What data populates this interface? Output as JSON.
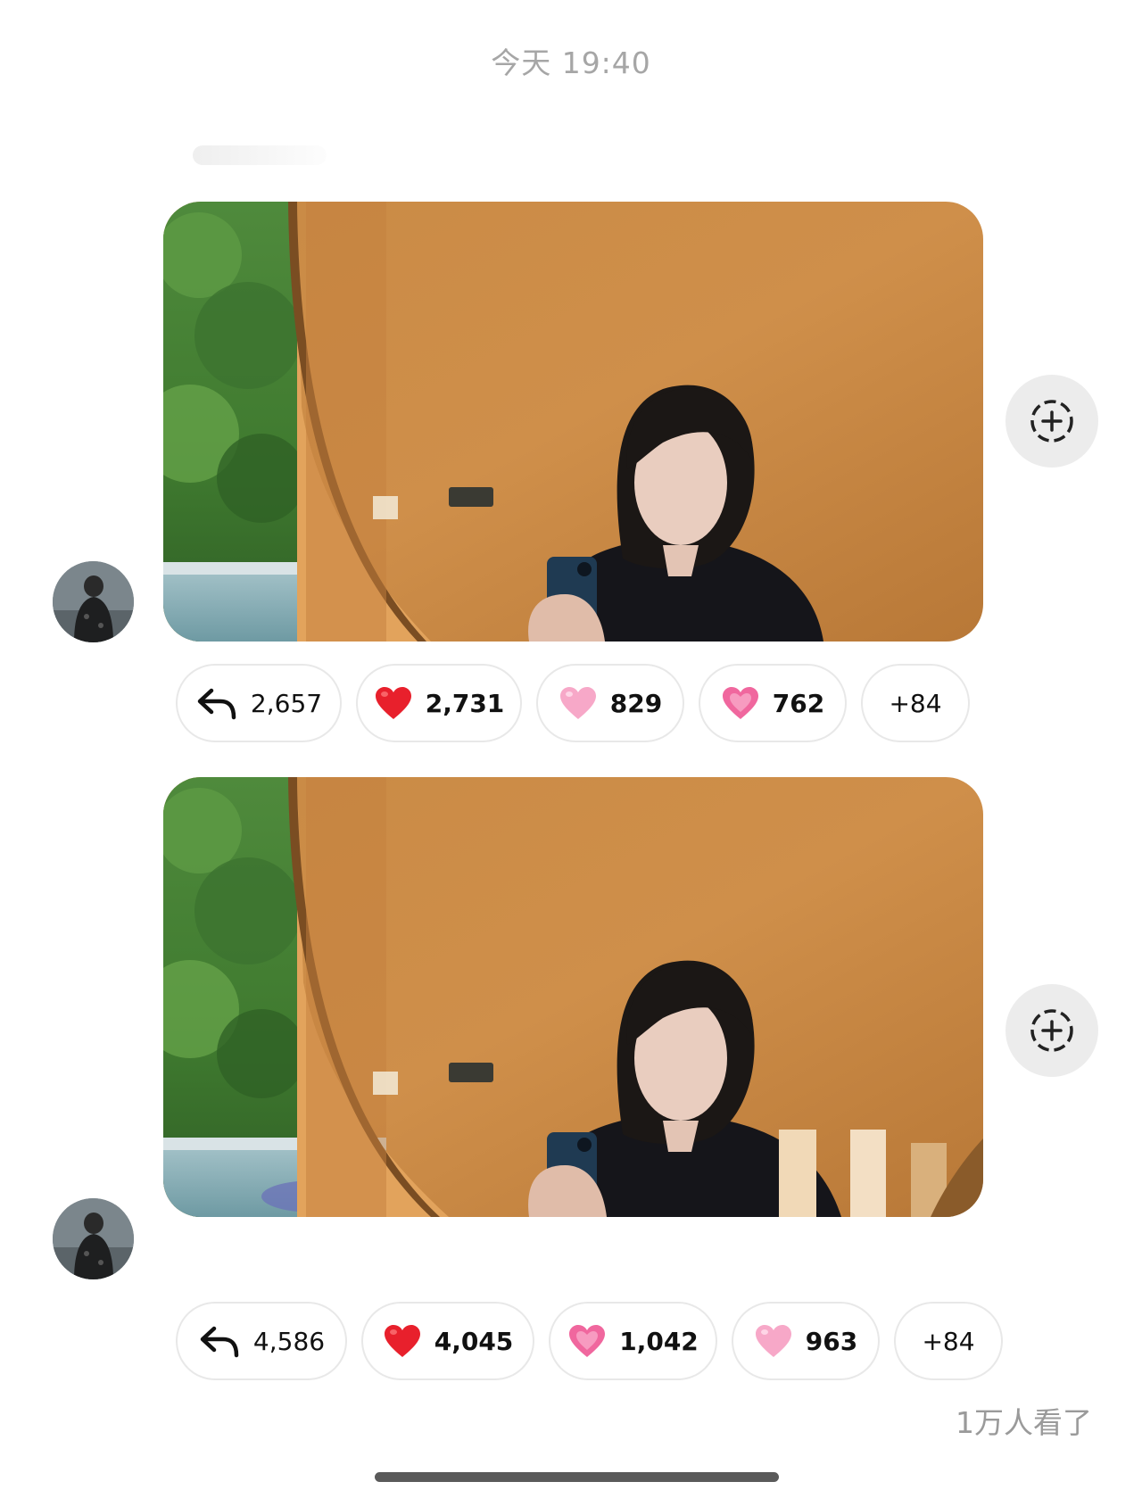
{
  "timestamp": "今天 19:40",
  "messages": [
    {
      "reactions": [
        {
          "icon": "reply-arrow-icon",
          "count": "2,657"
        },
        {
          "icon": "red-heart-icon",
          "count": "2,731",
          "color": "#e8202c"
        },
        {
          "icon": "pink-heart-icon",
          "count": "829",
          "color": "#f7a8c8"
        },
        {
          "icon": "growing-heart-icon",
          "count": "762",
          "color": "#f0679e"
        },
        {
          "icon": "",
          "count": "+84"
        }
      ]
    },
    {
      "reactions": [
        {
          "icon": "reply-arrow-icon",
          "count": "4,586"
        },
        {
          "icon": "red-heart-icon",
          "count": "4,045",
          "color": "#e8202c"
        },
        {
          "icon": "growing-heart-icon",
          "count": "1,042",
          "color": "#f0679e"
        },
        {
          "icon": "pink-heart-icon",
          "count": "963",
          "color": "#f7a8c8"
        },
        {
          "icon": "",
          "count": "+84"
        }
      ]
    }
  ],
  "view_count": "1万人看了"
}
